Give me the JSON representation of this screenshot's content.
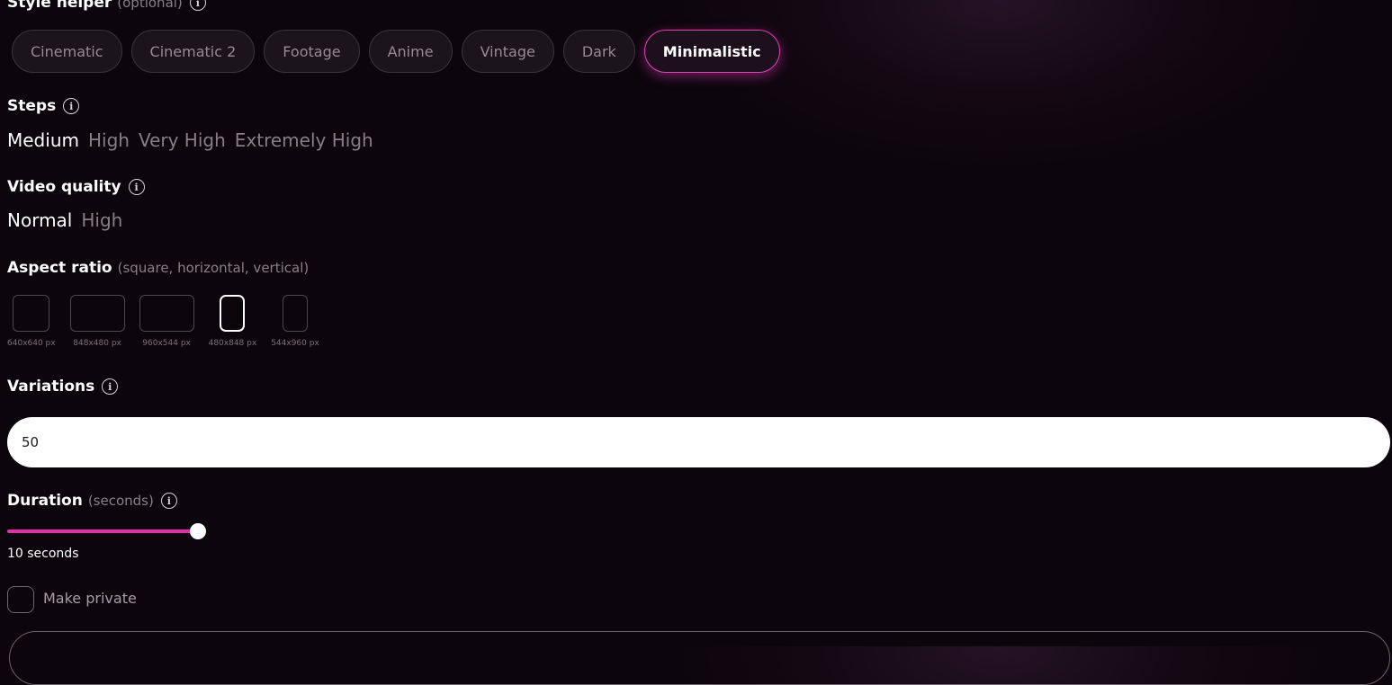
{
  "style_helper": {
    "label": "Style helper",
    "hint": "(optional)",
    "options": [
      "Cinematic",
      "Cinematic 2",
      "Footage",
      "Anime",
      "Vintage",
      "Dark",
      "Minimalistic"
    ],
    "selected": "Minimalistic"
  },
  "steps": {
    "label": "Steps",
    "options": [
      "Medium",
      "High",
      "Very High",
      "Extremely High"
    ],
    "selected": "Medium"
  },
  "video_quality": {
    "label": "Video quality",
    "options": [
      "Normal",
      "High"
    ],
    "selected": "Normal"
  },
  "aspect_ratio": {
    "label": "Aspect ratio",
    "hint": "(square, horizontal, vertical)",
    "options": [
      "640x640 px",
      "848x480 px",
      "960x544 px",
      "480x848 px",
      "544x960 px"
    ],
    "selected": "480x848 px"
  },
  "variations": {
    "label": "Variations",
    "value": "50"
  },
  "duration": {
    "label": "Duration",
    "hint": "(seconds)",
    "value_text": "10 seconds",
    "value": 10,
    "fill_fraction": 1.0
  },
  "make_private": {
    "label": "Make private",
    "checked": false
  },
  "colors": {
    "accent": "#e32fa9",
    "background": "#0c050c"
  }
}
